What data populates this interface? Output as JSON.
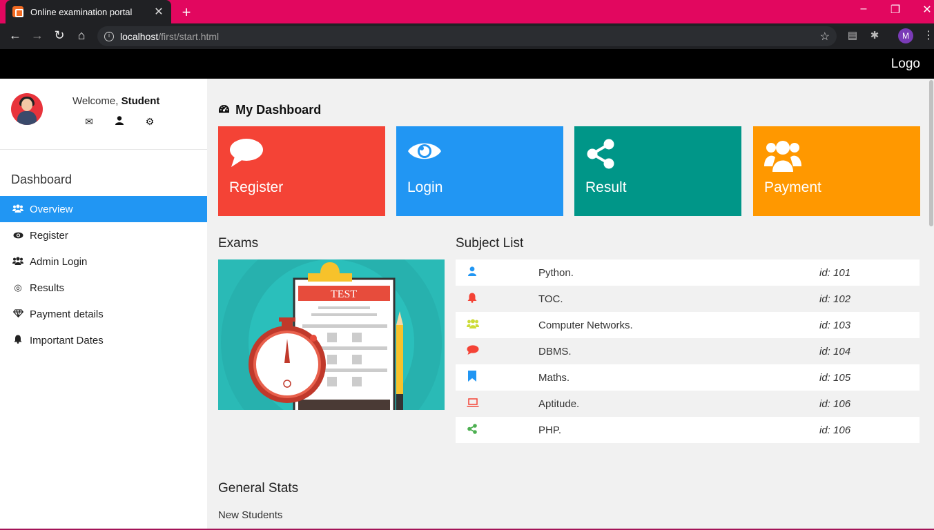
{
  "browser": {
    "tab_title": "Online examination portal",
    "url_host": "localhost",
    "url_path": "/first/start.html",
    "profile_initial": "M",
    "accent": "#e2075f"
  },
  "header": {
    "logo": "Logo"
  },
  "sidebar": {
    "welcome_prefix": "Welcome, ",
    "username": "Student",
    "section_title": "Dashboard",
    "items": [
      {
        "label": "Overview",
        "icon": "users-icon",
        "active": true
      },
      {
        "label": "Register",
        "icon": "eye-icon",
        "active": false
      },
      {
        "label": "Admin Login",
        "icon": "users-icon",
        "active": false
      },
      {
        "label": "Results",
        "icon": "bullseye-icon",
        "active": false
      },
      {
        "label": "Payment details",
        "icon": "diamond-icon",
        "active": false
      },
      {
        "label": "Important Dates",
        "icon": "bell-icon",
        "active": false
      }
    ]
  },
  "main": {
    "title": "My Dashboard",
    "tiles": [
      {
        "label": "Register",
        "color": "#f44336",
        "icon": "comment-icon"
      },
      {
        "label": "Login",
        "color": "#2196f3",
        "icon": "eye-icon"
      },
      {
        "label": "Result",
        "color": "#009688",
        "icon": "share-icon"
      },
      {
        "label": "Payment",
        "color": "#ff9800",
        "icon": "users-icon"
      }
    ],
    "exams_title": "Exams",
    "exam_image_text": "TEST",
    "subjects_title": "Subject List",
    "subjects": [
      {
        "name": "Python.",
        "id": "id: 101",
        "icon": "user-icon",
        "icon_color": "#2196f3"
      },
      {
        "name": "TOC.",
        "id": "id: 102",
        "icon": "bell-icon",
        "icon_color": "#f44336"
      },
      {
        "name": "Computer Networks.",
        "id": "id: 103",
        "icon": "users-icon",
        "icon_color": "#cddc39"
      },
      {
        "name": "DBMS.",
        "id": "id: 104",
        "icon": "comment-icon",
        "icon_color": "#f44336"
      },
      {
        "name": "Maths.",
        "id": "id: 105",
        "icon": "bookmark-icon",
        "icon_color": "#2196f3"
      },
      {
        "name": "Aptitude.",
        "id": "id: 106",
        "icon": "laptop-icon",
        "icon_color": "#f44336"
      },
      {
        "name": "PHP.",
        "id": "id: 106",
        "icon": "share-icon",
        "icon_color": "#4caf50"
      }
    ],
    "stats_title": "General Stats",
    "stats_first": "New Students"
  }
}
